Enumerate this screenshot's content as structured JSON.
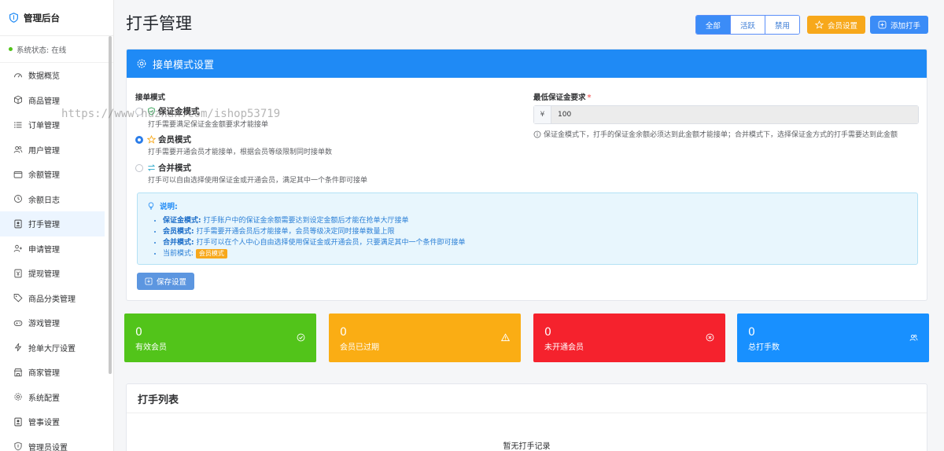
{
  "sidebar": {
    "title": "管理后台",
    "status": "系统状态: 在线",
    "items": [
      {
        "label": "数据概览",
        "icon": "dashboard-icon"
      },
      {
        "label": "商品管理",
        "icon": "box-icon"
      },
      {
        "label": "订单管理",
        "icon": "list-icon"
      },
      {
        "label": "用户管理",
        "icon": "users-icon"
      },
      {
        "label": "余额管理",
        "icon": "wallet-icon"
      },
      {
        "label": "余额日志",
        "icon": "clock-icon"
      },
      {
        "label": "打手管理",
        "icon": "id-card-icon"
      },
      {
        "label": "申请管理",
        "icon": "user-plus-icon"
      },
      {
        "label": "提现管理",
        "icon": "cash-icon"
      },
      {
        "label": "商品分类管理",
        "icon": "tag-icon"
      },
      {
        "label": "游戏管理",
        "icon": "gamepad-icon"
      },
      {
        "label": "抢单大厅设置",
        "icon": "bolt-icon"
      },
      {
        "label": "商家管理",
        "icon": "store-icon"
      },
      {
        "label": "系统配置",
        "icon": "gear-icon"
      },
      {
        "label": "管事设置",
        "icon": "badge-icon"
      },
      {
        "label": "管理员设置",
        "icon": "shield-icon"
      }
    ],
    "active_index": 6
  },
  "page": {
    "title": "打手管理",
    "filters": [
      "全部",
      "活跃",
      "禁用"
    ],
    "member_settings_label": "会员设置",
    "add_label": "添加打手"
  },
  "mode_panel": {
    "title": "接单模式设置",
    "mode_label": "接单模式",
    "options": [
      {
        "title": "保证金模式",
        "desc": "打手需要满足保证金金额要求才能接单",
        "checked": false
      },
      {
        "title": "会员模式",
        "desc": "打手需要开通会员才能接单，根据会员等级限制同时接单数",
        "checked": true
      },
      {
        "title": "合并模式",
        "desc": "打手可以自由选择使用保证金或开通会员，满足其中一个条件即可接单",
        "checked": false
      }
    ],
    "deposit_label": "最低保证金要求",
    "required_mark": "*",
    "currency": "¥",
    "deposit_value": "100",
    "hint": "保证金模式下，打手的保证金余额必须达到此金额才能接单；合并模式下，选择保证金方式的打手需要达到此金额",
    "note": {
      "title": "说明:",
      "items": [
        {
          "key": "保证金模式:",
          "text": "打手账户中的保证金余额需要达到设定金额后才能在抢单大厅接单"
        },
        {
          "key": "会员模式:",
          "text": "打手需要开通会员后才能接单，会员等级决定同时接单数量上限"
        },
        {
          "key": "合并模式:",
          "text": "打手可以在个人中心自由选择使用保证金或开通会员，只要满足其中一个条件即可接单"
        }
      ],
      "current_label": "当前模式:",
      "current_value": "会员模式"
    },
    "save_label": "保存设置"
  },
  "stats": [
    {
      "value": "0",
      "label": "有效会员",
      "color": "#52c41a",
      "icon": "check-circle-icon"
    },
    {
      "value": "0",
      "label": "会员已过期",
      "color": "#faad14",
      "icon": "warning-icon"
    },
    {
      "value": "0",
      "label": "未开通会员",
      "color": "#f5222d",
      "icon": "x-circle-icon"
    },
    {
      "value": "0",
      "label": "总打手数",
      "color": "#1890ff",
      "icon": "users-icon"
    }
  ],
  "list": {
    "title": "打手列表",
    "empty": "暂无打手记录"
  },
  "watermark": "https://www.huzhan.com/ishop53719"
}
